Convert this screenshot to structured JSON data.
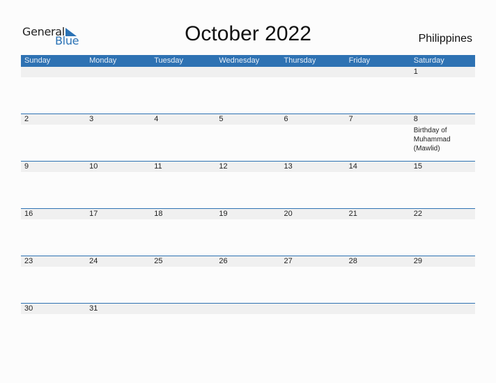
{
  "logo": {
    "general": "General",
    "blue": "Blue"
  },
  "title": "October 2022",
  "country": "Philippines",
  "weekdays": [
    "Sunday",
    "Monday",
    "Tuesday",
    "Wednesday",
    "Thursday",
    "Friday",
    "Saturday"
  ],
  "weeks": [
    [
      {
        "day": ""
      },
      {
        "day": ""
      },
      {
        "day": ""
      },
      {
        "day": ""
      },
      {
        "day": ""
      },
      {
        "day": ""
      },
      {
        "day": "1"
      }
    ],
    [
      {
        "day": "2"
      },
      {
        "day": "3"
      },
      {
        "day": "4"
      },
      {
        "day": "5"
      },
      {
        "day": "6"
      },
      {
        "day": "7"
      },
      {
        "day": "8",
        "event": "Birthday of Muhammad (Mawlid)"
      }
    ],
    [
      {
        "day": "9"
      },
      {
        "day": "10"
      },
      {
        "day": "11"
      },
      {
        "day": "12"
      },
      {
        "day": "13"
      },
      {
        "day": "14"
      },
      {
        "day": "15"
      }
    ],
    [
      {
        "day": "16"
      },
      {
        "day": "17"
      },
      {
        "day": "18"
      },
      {
        "day": "19"
      },
      {
        "day": "20"
      },
      {
        "day": "21"
      },
      {
        "day": "22"
      }
    ],
    [
      {
        "day": "23"
      },
      {
        "day": "24"
      },
      {
        "day": "25"
      },
      {
        "day": "26"
      },
      {
        "day": "27"
      },
      {
        "day": "28"
      },
      {
        "day": "29"
      }
    ],
    [
      {
        "day": "30"
      },
      {
        "day": "31"
      },
      {
        "day": ""
      },
      {
        "day": ""
      },
      {
        "day": ""
      },
      {
        "day": ""
      },
      {
        "day": ""
      }
    ]
  ],
  "colors": {
    "header": "#2e72b3",
    "accent": "#2a72b5",
    "day_bar": "#f0f0f0"
  }
}
